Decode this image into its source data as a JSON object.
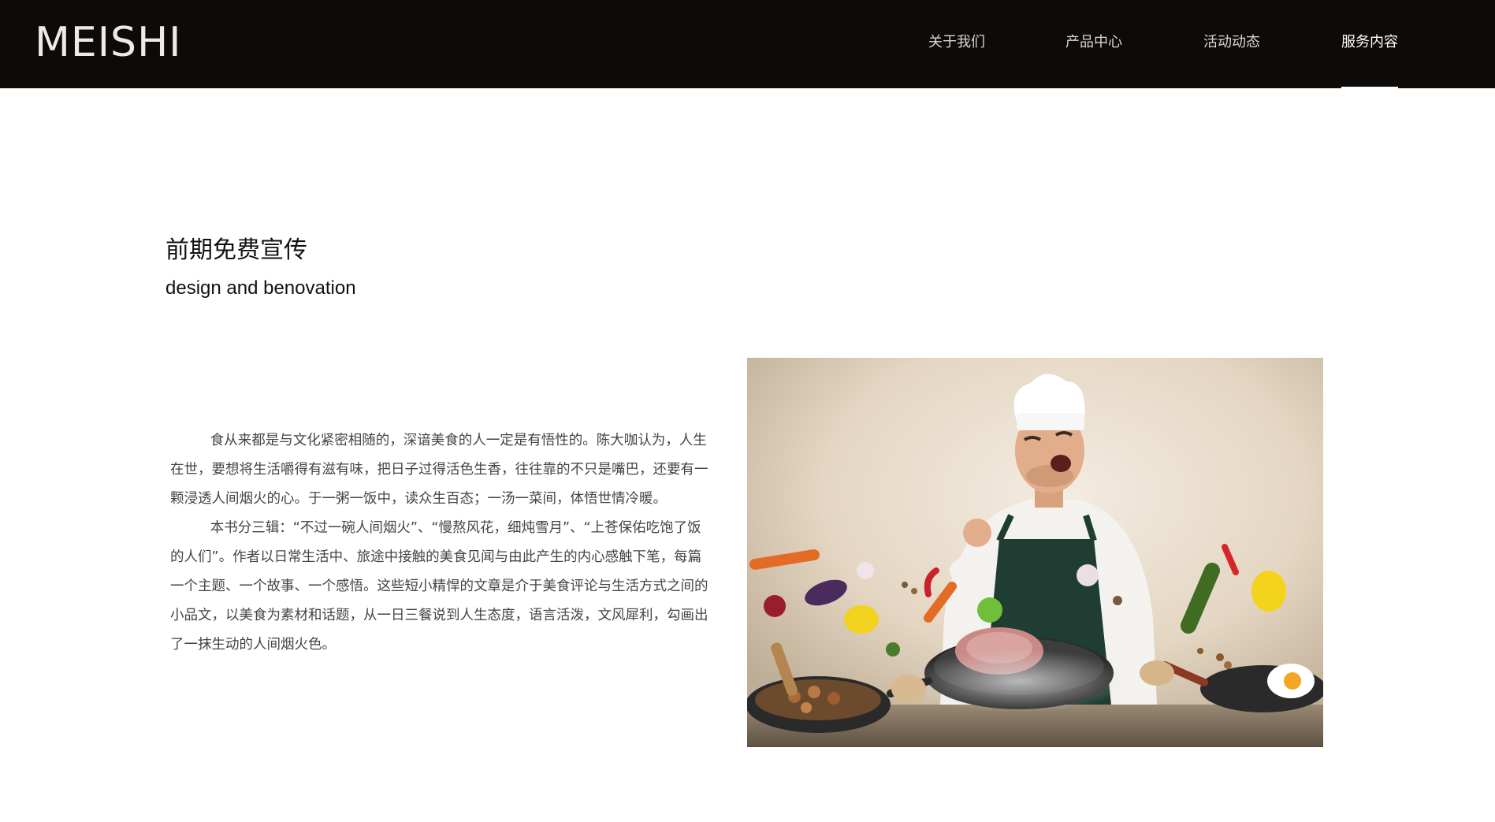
{
  "header": {
    "logo": "MEISHI",
    "nav": [
      {
        "label": "关于我们",
        "active": false
      },
      {
        "label": "产品中心",
        "active": false
      },
      {
        "label": "活动动态",
        "active": false
      },
      {
        "label": "服务内容",
        "active": true
      }
    ]
  },
  "section": {
    "title_zh": "前期免费宣传",
    "title_en": "design and benovation",
    "paragraphs": [
      "食从来都是与文化紧密相随的，深谙美食的人一定是有悟性的。陈大咖认为，人生在世，要想将生活嚼得有滋有味，把日子过得活色生香，往往靠的不只是嘴巴，还要有一颗浸透人间烟火的心。于一粥一饭中，读众生百态；一汤一菜间，体悟世情冷暖。",
      "本书分三辑：“不过一碗人间烟火”、“慢熬风花，细炖雪月”、“上苍保佑吃饱了饭的人们”。作者以日常生活中、旅途中接触的美食见闻与由此产生的内心感触下笔，每篇一个主题、一个故事、一个感悟。这些短小精悍的文章是介于美食评论与生活方式之间的小品文，以美食为素材和话题，从一日三餐说到人生态度，语言活泼，文风犀利，勾画出了一抹生动的人间烟火色。"
    ]
  },
  "colors": {
    "header_bg": "#0e0a08",
    "nav_text": "#d9d6d3",
    "nav_active": "#ffffff",
    "body_text": "#444444"
  }
}
